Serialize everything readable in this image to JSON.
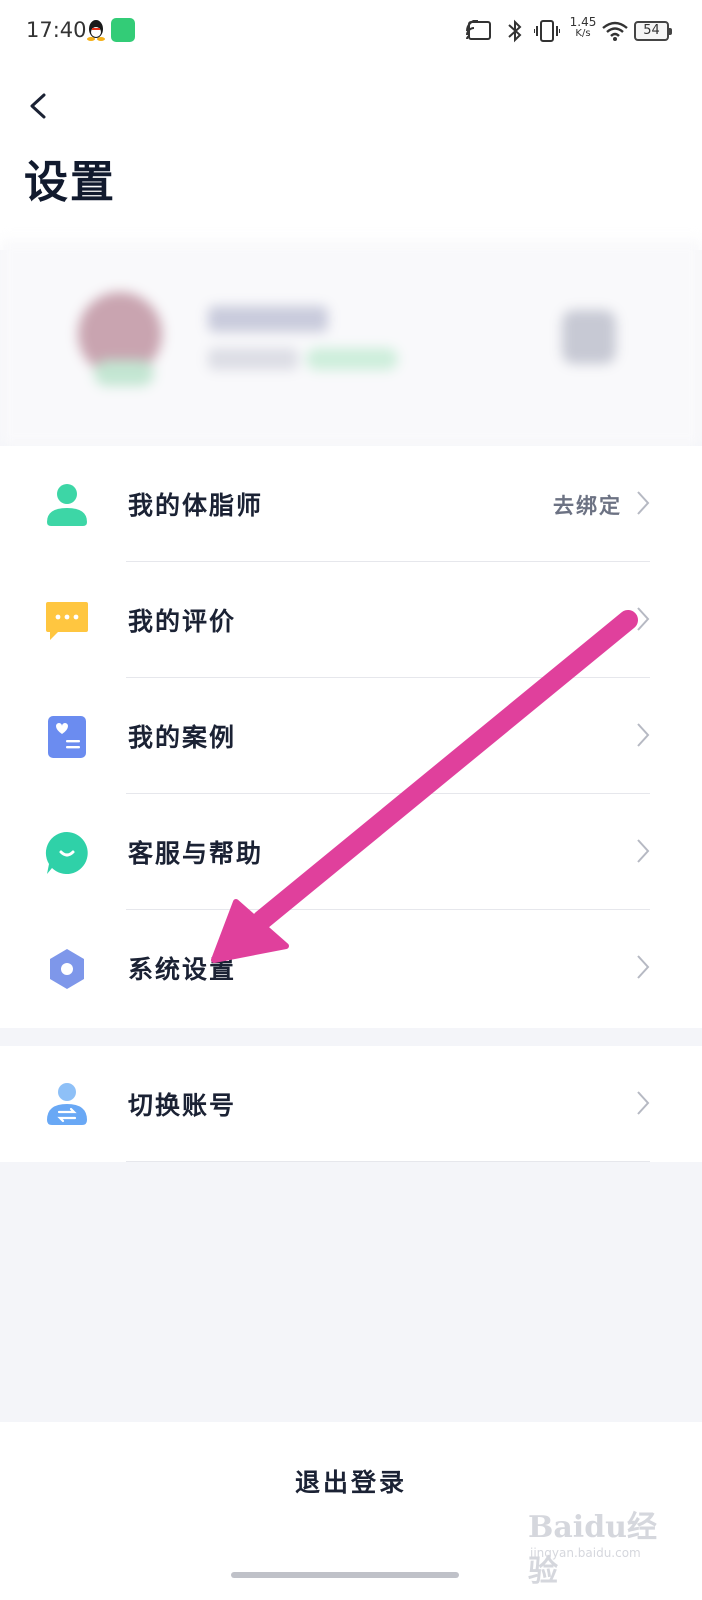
{
  "status_bar": {
    "time": "17:40",
    "network_speed_value": "1.45",
    "network_speed_unit": "K/s",
    "battery": "54",
    "icons": [
      "qq-icon",
      "app-icon",
      "cast-icon",
      "bluetooth-icon",
      "vibrate-icon",
      "wifi-icon"
    ]
  },
  "header": {
    "title": "设置"
  },
  "menu": {
    "items": [
      {
        "label": "我的体脂师",
        "value": "去绑定",
        "icon": "user-icon",
        "icon_color": "#3dd6a6"
      },
      {
        "label": "我的评价",
        "value": "",
        "icon": "chat-bubble-icon",
        "icon_color": "#ffc640"
      },
      {
        "label": "我的案例",
        "value": "",
        "icon": "case-card-icon",
        "icon_color": "#6b8cf0"
      },
      {
        "label": "客服与帮助",
        "value": "",
        "icon": "support-chat-icon",
        "icon_color": "#2fd1a8"
      },
      {
        "label": "系统设置",
        "value": "",
        "icon": "hexagon-settings-icon",
        "icon_color": "#7e97ea"
      }
    ],
    "switch_account": {
      "label": "切换账号",
      "icon": "switch-user-icon",
      "icon_color": "#69a8f5"
    }
  },
  "footer": {
    "logout_label": "退出登录"
  },
  "watermark": {
    "main": "Baidu经验",
    "sub": "jingyan.baidu.com"
  },
  "colors": {
    "annotation_arrow": "#e0409c",
    "background": "#f4f5f9",
    "text_primary": "#1b2234"
  }
}
